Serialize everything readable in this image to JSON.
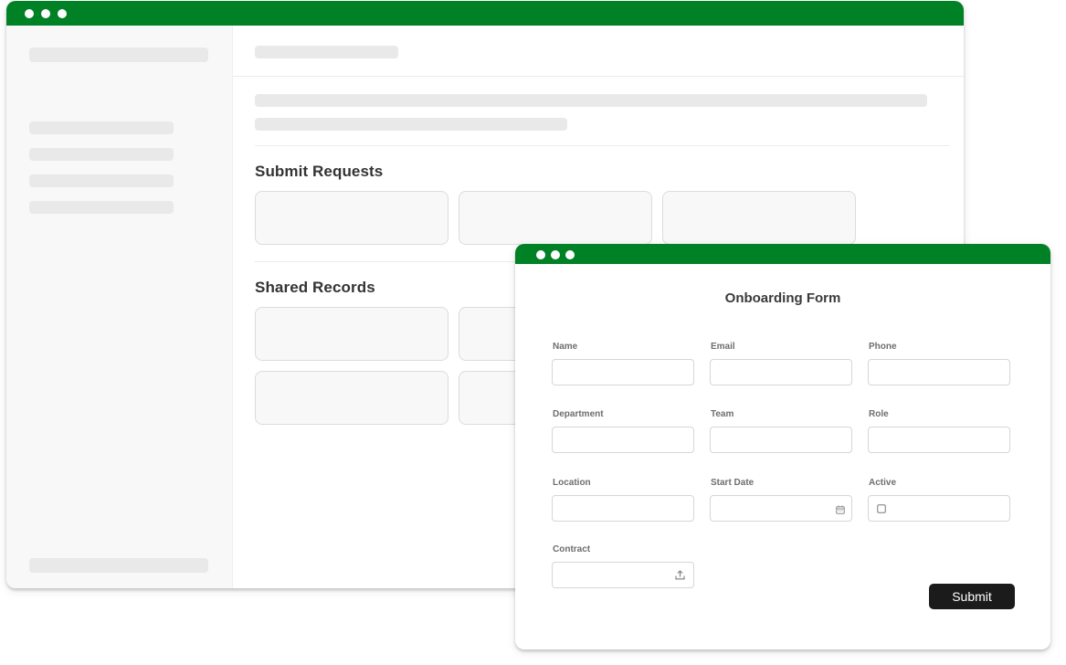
{
  "theme": {
    "accent": "#008126",
    "button_bg": "#1b1b1b"
  },
  "main": {
    "sections": [
      {
        "title": "Submit Requests"
      },
      {
        "title": "Shared Records"
      }
    ]
  },
  "form": {
    "title": "Onboarding Form",
    "fields": {
      "name": {
        "label": "Name",
        "value": ""
      },
      "email": {
        "label": "Email",
        "value": ""
      },
      "phone": {
        "label": "Phone",
        "value": ""
      },
      "department": {
        "label": "Department",
        "value": ""
      },
      "team": {
        "label": "Team",
        "value": ""
      },
      "role": {
        "label": "Role",
        "value": ""
      },
      "location": {
        "label": "Location",
        "value": ""
      },
      "start_date": {
        "label": "Start Date",
        "value": "",
        "icon": "calendar-icon"
      },
      "active": {
        "label": "Active",
        "checked": false,
        "icon": "checkbox-icon"
      },
      "contract": {
        "label": "Contract",
        "value": "",
        "icon": "upload-icon"
      }
    },
    "submit_label": "Submit"
  }
}
